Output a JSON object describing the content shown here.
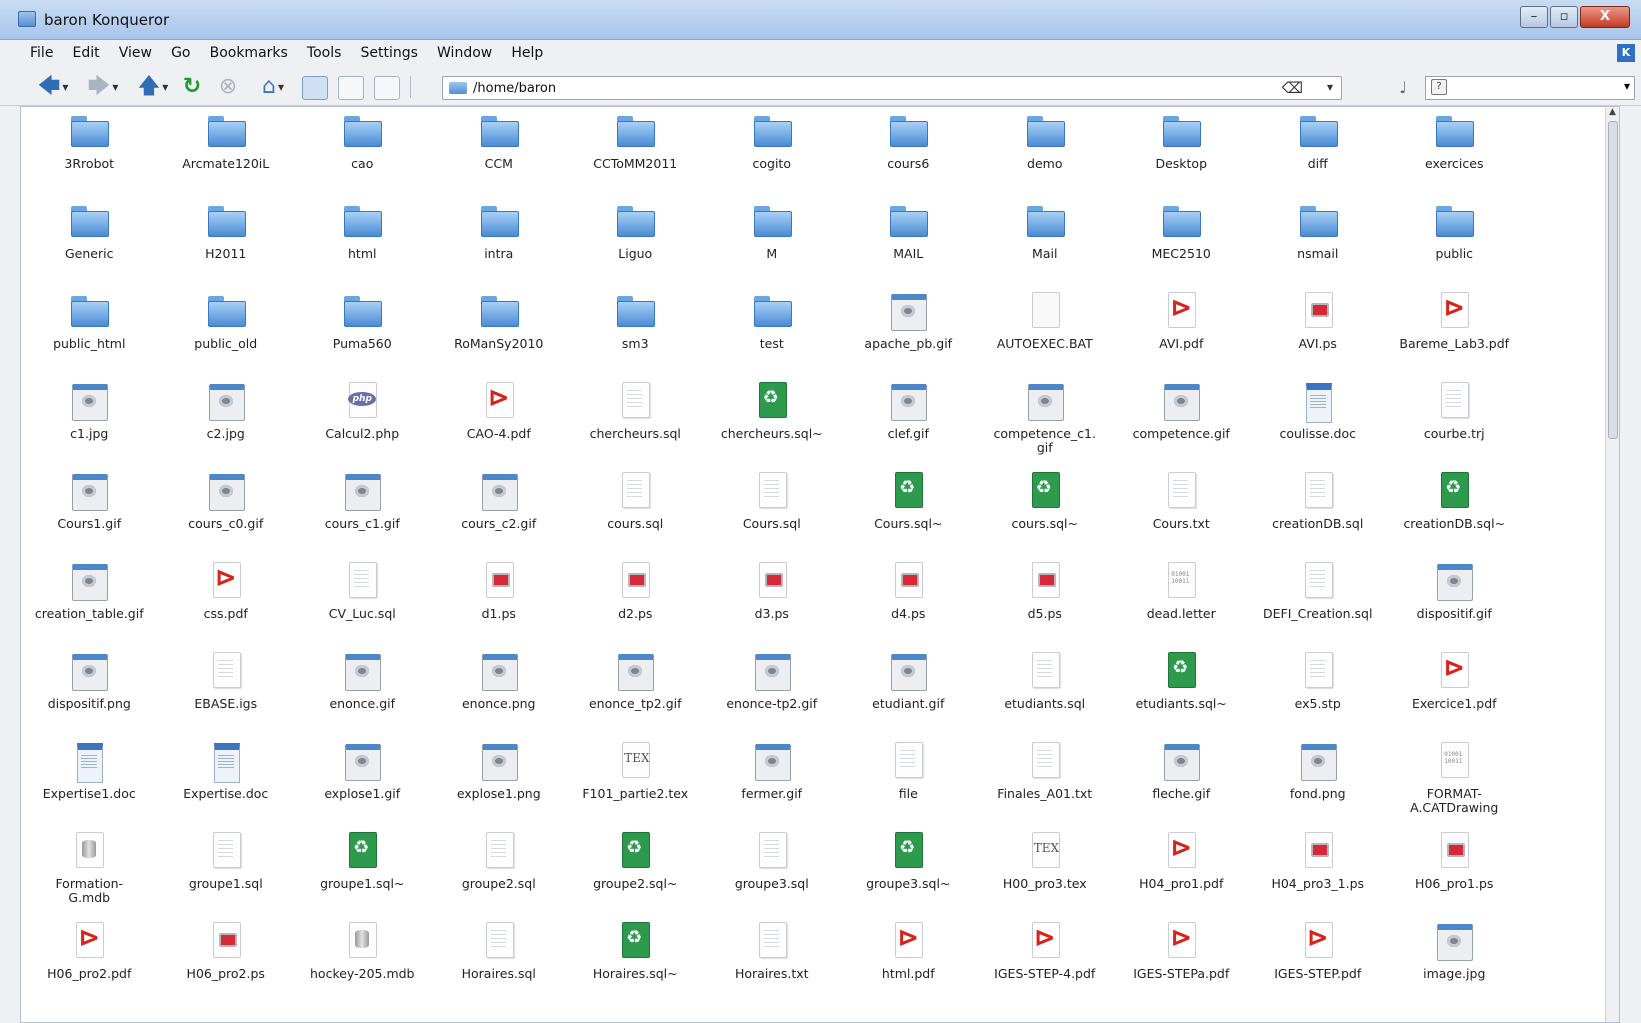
{
  "window": {
    "title": "baron  Konqueror",
    "min_label": "–",
    "max_label": "▫",
    "close_label": "X"
  },
  "menu": {
    "file": "File",
    "edit": "Edit",
    "view": "View",
    "go": "Go",
    "bookmarks": "Bookmarks",
    "tools": "Tools",
    "settings": "Settings",
    "window": "Window",
    "help": "Help"
  },
  "toolbar": {
    "back": "🡄",
    "forward": "🡆",
    "up": "🡅",
    "reload": "↻",
    "stop": "⊗",
    "home": "⌂"
  },
  "location": {
    "path": "/home/baron",
    "clear": "⌫",
    "dropdown": "▾"
  },
  "search": {
    "placeholder": "",
    "dropdown": "▾"
  },
  "colors": {
    "accent": "#4b8bd3",
    "pdf": "#d6231b",
    "backup": "#2d9a4d"
  },
  "files": [
    {
      "name": "3Rrobot",
      "type": "folder"
    },
    {
      "name": "Arcmate120iL",
      "type": "folder"
    },
    {
      "name": "cao",
      "type": "folder"
    },
    {
      "name": "CCM",
      "type": "folder"
    },
    {
      "name": "CCToMM2011",
      "type": "folder"
    },
    {
      "name": "cogito",
      "type": "folder"
    },
    {
      "name": "cours6",
      "type": "folder"
    },
    {
      "name": "demo",
      "type": "folder"
    },
    {
      "name": "Desktop",
      "type": "folder"
    },
    {
      "name": "diff",
      "type": "folder"
    },
    {
      "name": "exercices",
      "type": "folder"
    },
    {
      "name": "Generic",
      "type": "folder"
    },
    {
      "name": "H2011",
      "type": "folder"
    },
    {
      "name": "html",
      "type": "folder"
    },
    {
      "name": "intra",
      "type": "folder"
    },
    {
      "name": "Liguo",
      "type": "folder"
    },
    {
      "name": "M",
      "type": "folder"
    },
    {
      "name": "MAIL",
      "type": "folder"
    },
    {
      "name": "Mail",
      "type": "folder"
    },
    {
      "name": "MEC2510",
      "type": "folder"
    },
    {
      "name": "nsmail",
      "type": "folder"
    },
    {
      "name": "public",
      "type": "folder"
    },
    {
      "name": "public_html",
      "type": "folder"
    },
    {
      "name": "public_old",
      "type": "folder"
    },
    {
      "name": "Puma560",
      "type": "folder"
    },
    {
      "name": "RoManSy2010",
      "type": "folder"
    },
    {
      "name": "sm3",
      "type": "folder"
    },
    {
      "name": "test",
      "type": "folder"
    },
    {
      "name": "apache_pb.gif",
      "type": "img"
    },
    {
      "name": "AUTOEXEC.BAT",
      "type": "blank"
    },
    {
      "name": "AVI.pdf",
      "type": "pdf"
    },
    {
      "name": "AVI.ps",
      "type": "ps"
    },
    {
      "name": "Bareme_Lab3.pdf",
      "type": "pdf"
    },
    {
      "name": "c1.jpg",
      "type": "img"
    },
    {
      "name": "c2.jpg",
      "type": "img"
    },
    {
      "name": "Calcul2.php",
      "type": "php"
    },
    {
      "name": "CAO-4.pdf",
      "type": "pdf"
    },
    {
      "name": "chercheurs.sql",
      "type": "doc"
    },
    {
      "name": "chercheurs.sql~",
      "type": "bak"
    },
    {
      "name": "clef.gif",
      "type": "img"
    },
    {
      "name": "competence_c1.\ngif",
      "type": "img"
    },
    {
      "name": "competence.gif",
      "type": "img"
    },
    {
      "name": "coulisse.doc",
      "type": "docx"
    },
    {
      "name": "courbe.trj",
      "type": "doc"
    },
    {
      "name": "Cours1.gif",
      "type": "img"
    },
    {
      "name": "cours_c0.gif",
      "type": "img"
    },
    {
      "name": "cours_c1.gif",
      "type": "img"
    },
    {
      "name": "cours_c2.gif",
      "type": "img"
    },
    {
      "name": "cours.sql",
      "type": "doc"
    },
    {
      "name": "Cours.sql",
      "type": "doc"
    },
    {
      "name": "Cours.sql~",
      "type": "bak"
    },
    {
      "name": "cours.sql~",
      "type": "bak"
    },
    {
      "name": "Cours.txt",
      "type": "doc"
    },
    {
      "name": "creationDB.sql",
      "type": "doc"
    },
    {
      "name": "creationDB.sql~",
      "type": "bak"
    },
    {
      "name": "creation_table.gif",
      "type": "img"
    },
    {
      "name": "css.pdf",
      "type": "pdf"
    },
    {
      "name": "CV_Luc.sql",
      "type": "doc"
    },
    {
      "name": "d1.ps",
      "type": "ps"
    },
    {
      "name": "d2.ps",
      "type": "ps"
    },
    {
      "name": "d3.ps",
      "type": "ps"
    },
    {
      "name": "d4.ps",
      "type": "ps"
    },
    {
      "name": "d5.ps",
      "type": "ps"
    },
    {
      "name": "dead.letter",
      "type": "bin"
    },
    {
      "name": "DEFI_Creation.sql",
      "type": "doc"
    },
    {
      "name": "dispositif.gif",
      "type": "img"
    },
    {
      "name": "dispositif.png",
      "type": "img"
    },
    {
      "name": "EBASE.igs",
      "type": "doc"
    },
    {
      "name": "enonce.gif",
      "type": "img"
    },
    {
      "name": "enonce.png",
      "type": "img"
    },
    {
      "name": "enonce_tp2.gif",
      "type": "img"
    },
    {
      "name": "enonce-tp2.gif",
      "type": "img"
    },
    {
      "name": "etudiant.gif",
      "type": "img"
    },
    {
      "name": "etudiants.sql",
      "type": "doc"
    },
    {
      "name": "etudiants.sql~",
      "type": "bak"
    },
    {
      "name": "ex5.stp",
      "type": "doc"
    },
    {
      "name": "Exercice1.pdf",
      "type": "pdf"
    },
    {
      "name": "Expertise1.doc",
      "type": "docx"
    },
    {
      "name": "Expertise.doc",
      "type": "docx"
    },
    {
      "name": "explose1.gif",
      "type": "img"
    },
    {
      "name": "explose1.png",
      "type": "img"
    },
    {
      "name": "F101_partie2.tex",
      "type": "tex"
    },
    {
      "name": "fermer.gif",
      "type": "img"
    },
    {
      "name": "file",
      "type": "doc"
    },
    {
      "name": "Finales_A01.txt",
      "type": "doc"
    },
    {
      "name": "fleche.gif",
      "type": "img"
    },
    {
      "name": "fond.png",
      "type": "img"
    },
    {
      "name": "FORMAT-\nA.CATDrawing",
      "type": "bin"
    },
    {
      "name": "Formation-\nG.mdb",
      "type": "db"
    },
    {
      "name": "groupe1.sql",
      "type": "doc"
    },
    {
      "name": "groupe1.sql~",
      "type": "bak"
    },
    {
      "name": "groupe2.sql",
      "type": "doc"
    },
    {
      "name": "groupe2.sql~",
      "type": "bak"
    },
    {
      "name": "groupe3.sql",
      "type": "doc"
    },
    {
      "name": "groupe3.sql~",
      "type": "bak"
    },
    {
      "name": "H00_pro3.tex",
      "type": "tex"
    },
    {
      "name": "H04_pro1.pdf",
      "type": "pdf"
    },
    {
      "name": "H04_pro3_1.ps",
      "type": "ps"
    },
    {
      "name": "H06_pro1.ps",
      "type": "ps"
    },
    {
      "name": "H06_pro2.pdf",
      "type": "pdf"
    },
    {
      "name": "H06_pro2.ps",
      "type": "ps"
    },
    {
      "name": "hockey-205.mdb",
      "type": "db"
    },
    {
      "name": "Horaires.sql",
      "type": "doc"
    },
    {
      "name": "Horaires.sql~",
      "type": "bak"
    },
    {
      "name": "Horaires.txt",
      "type": "doc"
    },
    {
      "name": "html.pdf",
      "type": "pdf"
    },
    {
      "name": "IGES-STEP-4.pdf",
      "type": "pdf"
    },
    {
      "name": "IGES-STEPa.pdf",
      "type": "pdf"
    },
    {
      "name": "IGES-STEP.pdf",
      "type": "pdf"
    },
    {
      "name": "image.jpg",
      "type": "img"
    }
  ]
}
